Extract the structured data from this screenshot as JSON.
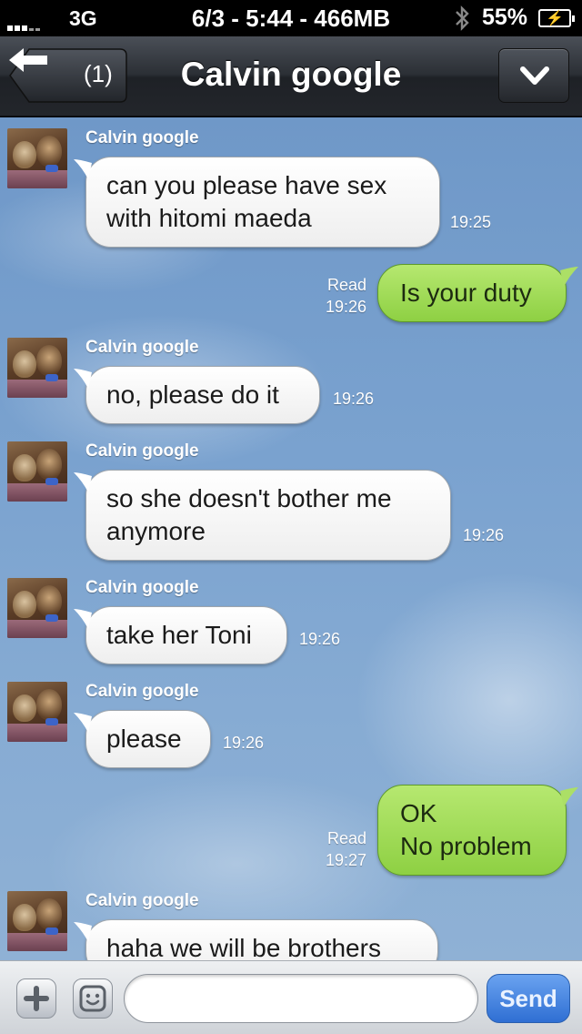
{
  "status_bar": {
    "carrier": "3G",
    "center_text": "6/3 - 5:44 - 466MB",
    "battery_percent": "55%",
    "bluetooth_icon": "bluetooth-icon",
    "battery_icon": "battery-charging-icon",
    "signal_icon": "signal-bars-icon"
  },
  "nav": {
    "back_label": "(1)",
    "back_icon": "arrow-left-icon",
    "title": "Calvin google",
    "menu_icon": "chevron-down-icon"
  },
  "messages": [
    {
      "direction": "in",
      "sender": "Calvin google",
      "lines": [
        "can you please have sex",
        "with hitomi maeda"
      ],
      "time": "19:25"
    },
    {
      "direction": "out",
      "read": "Read",
      "lines": [
        "Is your duty"
      ],
      "time": "19:26"
    },
    {
      "direction": "in",
      "sender": "Calvin google",
      "lines": [
        "no, please do it"
      ],
      "time": "19:26"
    },
    {
      "direction": "in",
      "sender": "Calvin google",
      "lines": [
        "so she doesn't bother me",
        "anymore"
      ],
      "time": "19:26"
    },
    {
      "direction": "in",
      "sender": "Calvin google",
      "lines": [
        "take her Toni"
      ],
      "time": "19:26"
    },
    {
      "direction": "in",
      "sender": "Calvin google",
      "lines": [
        "please"
      ],
      "time": "19:26"
    },
    {
      "direction": "out",
      "read": "Read",
      "lines": [
        "OK",
        "No problem"
      ],
      "time": "19:27"
    },
    {
      "direction": "in",
      "sender": "Calvin google",
      "lines": [
        "haha we will be brothers"
      ],
      "time": ""
    }
  ],
  "input_bar": {
    "plus_icon": "plus-icon",
    "emoji_icon": "emoji-face-icon",
    "input_value": "",
    "input_placeholder": "",
    "send_label": "Send"
  },
  "colors": {
    "outgoing_bubble": "#9fdc55",
    "incoming_bubble": "#ffffff",
    "send_button": "#3f7fe0",
    "nav_bar": "#2b2f35"
  }
}
